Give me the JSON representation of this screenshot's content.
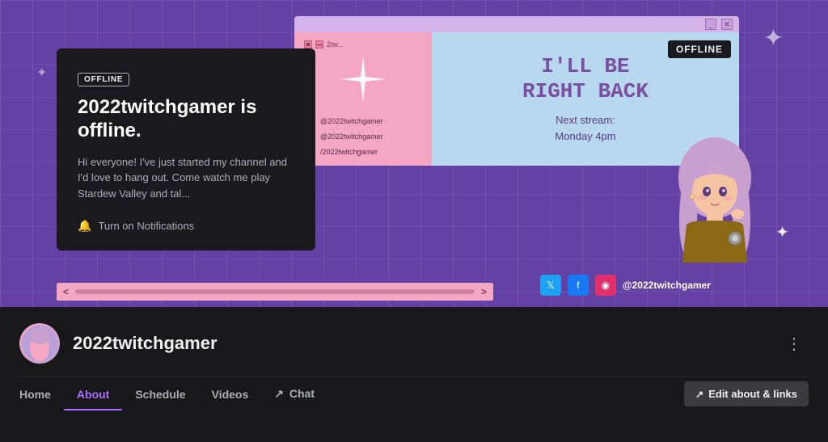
{
  "banner": {
    "offline_badge": "OFFLINE",
    "offline_title": "2022twitchgamer is offline.",
    "offline_desc": "Hi everyone! I've just started my channel and I'd love to hang out. Come watch me play Stardew Valley and tal...",
    "notify_label": "Turn on Notifications",
    "offline_top_right": "OFFLINE",
    "brb_text_line1": "I'LL BE",
    "brb_text_line2": "RIGHT BACK",
    "next_stream_label": "Next stream:",
    "next_stream_time": "Monday 4pm",
    "social_handle": "@2022twitchgamer",
    "social_twitter": "@2022twitchgamer",
    "social_instagram": "@2022twitchgamer",
    "social_youtube": "/2022twitchgamer",
    "scroll_left": "<",
    "scroll_right": ">"
  },
  "channel": {
    "avatar_emoji": "👧",
    "name": "2022twitchgamer",
    "kebab": "⋮"
  },
  "nav": {
    "home": "Home",
    "about": "About",
    "schedule": "Schedule",
    "videos": "Videos",
    "chat_icon": "↗",
    "chat": "Chat"
  },
  "edit_btn": {
    "icon": "↗",
    "label": "Edit about & links"
  },
  "icons": {
    "bell": "🔔",
    "star": "✦",
    "sparkle": "✦",
    "twitter": "𝕏",
    "instagram": "📷",
    "youtube": "▶"
  }
}
